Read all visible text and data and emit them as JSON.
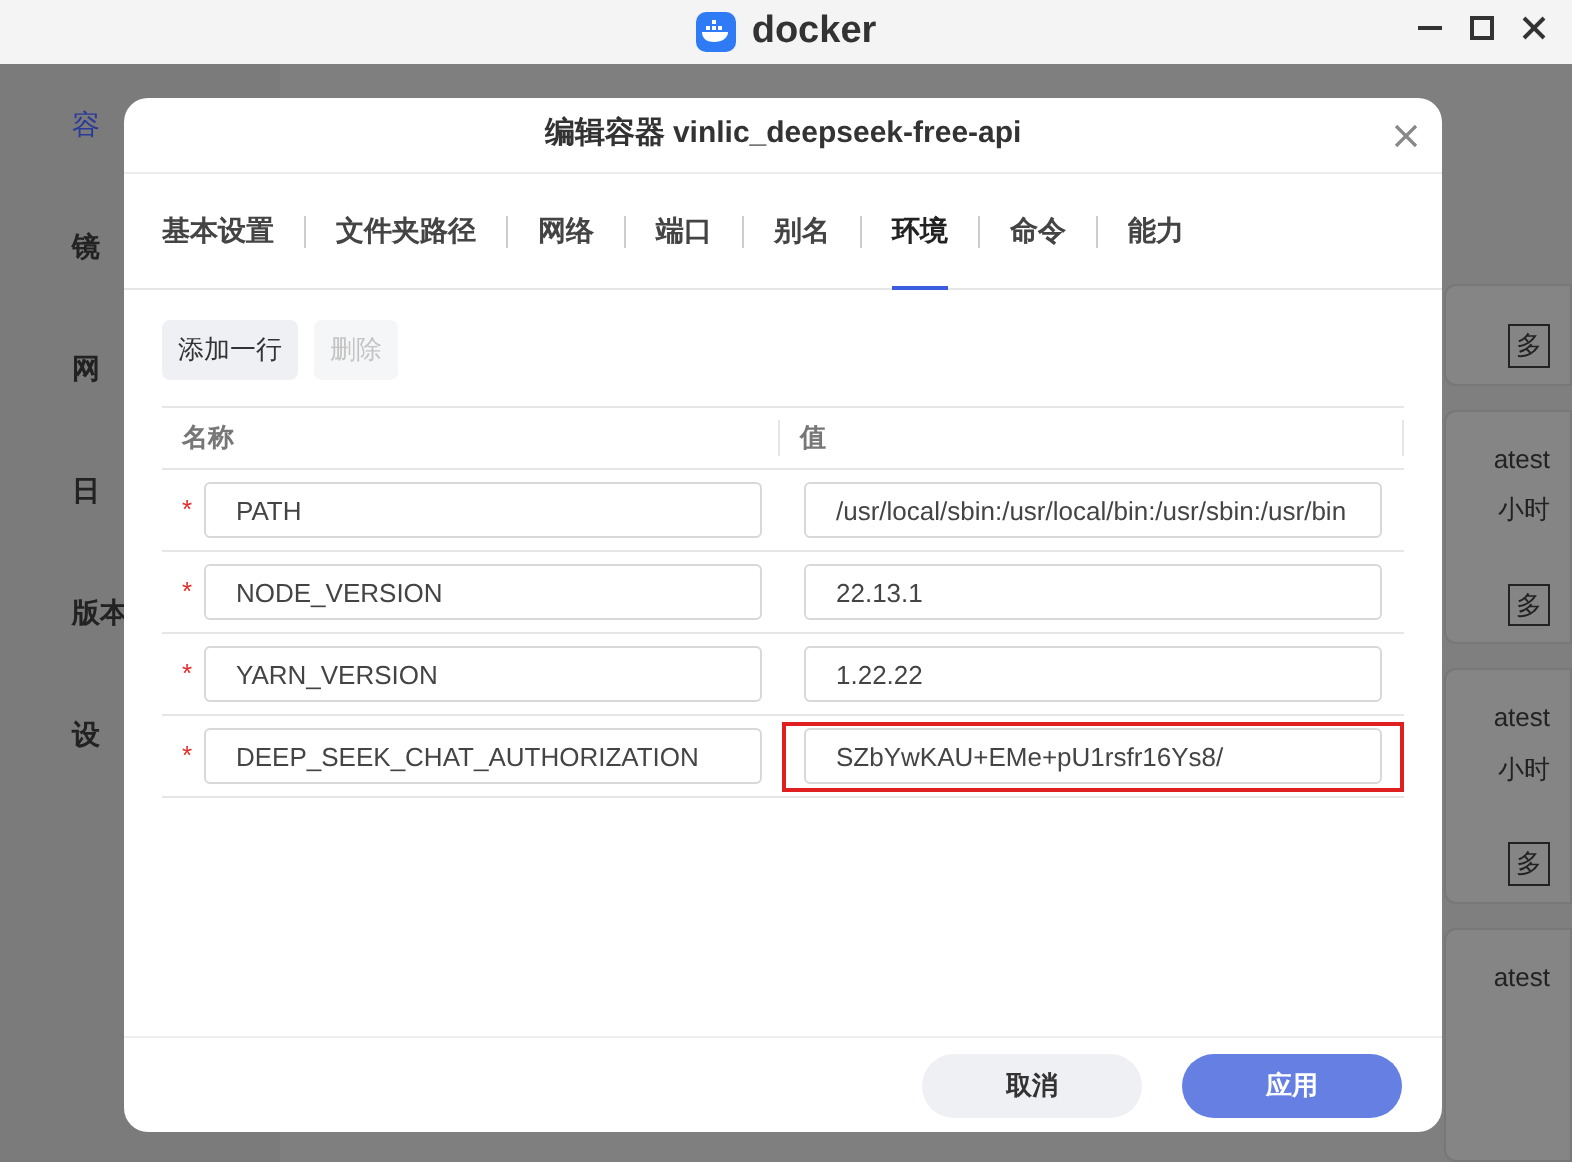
{
  "window": {
    "title": "docker"
  },
  "sidebar": {
    "items": [
      {
        "label": "容"
      },
      {
        "label": "镜"
      },
      {
        "label": "网"
      },
      {
        "label": "日"
      },
      {
        "label": "版本"
      },
      {
        "label": "设"
      }
    ]
  },
  "cards": [
    {
      "button": "多"
    },
    {
      "lines": [
        "atest",
        "小时"
      ],
      "button": "多"
    },
    {
      "lines": [
        "atest",
        "小时"
      ],
      "button": "多"
    },
    {
      "lines": [
        "atest"
      ]
    }
  ],
  "dialog": {
    "title": "编辑容器 vinlic_deepseek-free-api",
    "tabs": [
      {
        "label": "基本设置",
        "selected": false
      },
      {
        "label": "文件夹路径",
        "selected": false
      },
      {
        "label": "网络",
        "selected": false
      },
      {
        "label": "端口",
        "selected": false
      },
      {
        "label": "别名",
        "selected": false
      },
      {
        "label": "环境",
        "selected": true
      },
      {
        "label": "命令",
        "selected": false
      },
      {
        "label": "能力",
        "selected": false
      }
    ],
    "toolbar": [
      {
        "label": "添加一行",
        "disabled": false
      },
      {
        "label": "删除",
        "disabled": true
      }
    ],
    "table": {
      "columns": [
        "名称",
        "值"
      ],
      "rows": [
        {
          "name": "PATH",
          "value": "/usr/local/sbin:/usr/local/bin:/usr/sbin:/usr/bin",
          "mark": "*",
          "highlighted": false
        },
        {
          "name": "NODE_VERSION",
          "value": "22.13.1",
          "mark": "*",
          "highlighted": false
        },
        {
          "name": "YARN_VERSION",
          "value": "1.22.22",
          "mark": "*",
          "highlighted": false
        },
        {
          "name": "DEEP_SEEK_CHAT_AUTHORIZATION",
          "value": "SZbYwKAU+EMe+pU1rsfr16Ys8/",
          "mark": "*",
          "highlighted": true
        }
      ]
    },
    "buttons": [
      {
        "label": "取消",
        "kind": "secondary"
      },
      {
        "label": "应用",
        "kind": "primary"
      }
    ]
  }
}
